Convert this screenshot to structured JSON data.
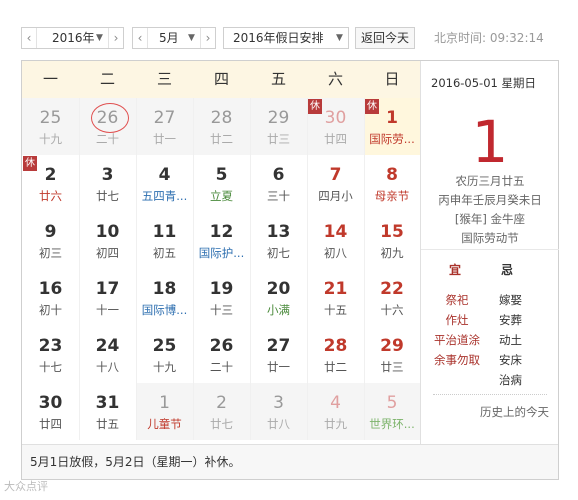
{
  "toolbar": {
    "year_value": "2016年",
    "month_value": "5月",
    "holiday_select": "2016年假日安排",
    "today_button": "返回今天",
    "clock_text": "北京时间: 09:32:14"
  },
  "weekdays": [
    "一",
    "二",
    "三",
    "四",
    "五",
    "六",
    "日"
  ],
  "weeks": [
    [
      {
        "n": "25",
        "s": "十九",
        "other": true
      },
      {
        "n": "26",
        "s": "二十",
        "other": true,
        "circled": true
      },
      {
        "n": "27",
        "s": "廿一",
        "other": true
      },
      {
        "n": "28",
        "s": "廿二",
        "other": true
      },
      {
        "n": "29",
        "s": "廿三",
        "other": true
      },
      {
        "n": "30",
        "s": "廿四",
        "other": true,
        "weekend": true,
        "rest": "休"
      },
      {
        "n": "1",
        "s": "国际劳...",
        "weekend": true,
        "fest": true,
        "rest": "休",
        "today": true
      }
    ],
    [
      {
        "n": "2",
        "s": "廿六",
        "fest": true,
        "rest": "休"
      },
      {
        "n": "3",
        "s": "廿七"
      },
      {
        "n": "4",
        "s": "五四青...",
        "term2": true
      },
      {
        "n": "5",
        "s": "立夏",
        "term": true
      },
      {
        "n": "6",
        "s": "三十"
      },
      {
        "n": "7",
        "s": "四月小",
        "weekend": true
      },
      {
        "n": "8",
        "s": "母亲节",
        "weekend": true,
        "fest": true
      }
    ],
    [
      {
        "n": "9",
        "s": "初三"
      },
      {
        "n": "10",
        "s": "初四"
      },
      {
        "n": "11",
        "s": "初五"
      },
      {
        "n": "12",
        "s": "国际护...",
        "term2": true
      },
      {
        "n": "13",
        "s": "初七"
      },
      {
        "n": "14",
        "s": "初八",
        "weekend": true
      },
      {
        "n": "15",
        "s": "初九",
        "weekend": true
      }
    ],
    [
      {
        "n": "16",
        "s": "初十"
      },
      {
        "n": "17",
        "s": "十一"
      },
      {
        "n": "18",
        "s": "国际博...",
        "term2": true
      },
      {
        "n": "19",
        "s": "十三"
      },
      {
        "n": "20",
        "s": "小满",
        "term": true
      },
      {
        "n": "21",
        "s": "十五",
        "weekend": true
      },
      {
        "n": "22",
        "s": "十六",
        "weekend": true
      }
    ],
    [
      {
        "n": "23",
        "s": "十七"
      },
      {
        "n": "24",
        "s": "十八"
      },
      {
        "n": "25",
        "s": "十九"
      },
      {
        "n": "26",
        "s": "二十"
      },
      {
        "n": "27",
        "s": "廿一"
      },
      {
        "n": "28",
        "s": "廿二",
        "weekend": true
      },
      {
        "n": "29",
        "s": "廿三",
        "weekend": true
      }
    ],
    [
      {
        "n": "30",
        "s": "廿四"
      },
      {
        "n": "31",
        "s": "廿五"
      },
      {
        "n": "1",
        "s": "儿童节",
        "other": true,
        "fest": true
      },
      {
        "n": "2",
        "s": "廿七",
        "other": true
      },
      {
        "n": "3",
        "s": "廿八",
        "other": true
      },
      {
        "n": "4",
        "s": "廿九",
        "other": true,
        "weekend": true
      },
      {
        "n": "5",
        "s": "世界环...",
        "other": true,
        "weekend": true,
        "term": true
      }
    ]
  ],
  "side": {
    "date_line": "2016-05-01  星期日",
    "big_day": "1",
    "lunar1": "农历三月廿五",
    "lunar2": "丙申年壬辰月癸未日",
    "lunar3": "[猴年] 金牛座",
    "lunar4": "国际劳动节",
    "yi_label": "宜",
    "ji_label": "忌",
    "yi_items": [
      "祭祀",
      "作灶",
      "平治道涂",
      "余事勿取"
    ],
    "ji_items": [
      "嫁娶",
      "安葬",
      "动土",
      "安床",
      "治病"
    ],
    "history": "历史上的今天"
  },
  "footer": "5月1日放假，5月2日（星期一）补休。",
  "watermark": "大众点评",
  "colors": {
    "accent": "#c0282f",
    "header_bg": "#fdf6e3"
  }
}
